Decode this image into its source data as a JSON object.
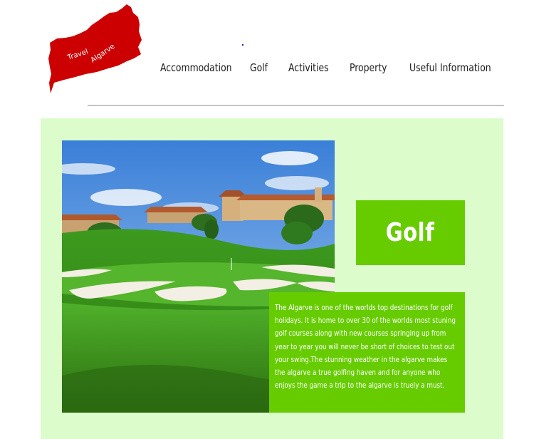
{
  "logo": {
    "line1": "Travel",
    "line2": "Algarve"
  },
  "nav": {
    "items": [
      {
        "label": "Accommodation"
      },
      {
        "label": "Golf"
      },
      {
        "label": "Activities"
      },
      {
        "label": "Property"
      },
      {
        "label": "Useful Information"
      }
    ]
  },
  "main": {
    "title": "Golf",
    "description": "The Algarve is one of the worlds top destinations for golf holidays. It is home to over 30 of the worlds most stuning golf courses along with new courses springing up from year to year you will never be short of choices to test out your swing.The stunning weather in the algarve makes the algarve a true golfing haven and for anyone who enjoys the game a trip to the algarve is truely a must."
  },
  "colors": {
    "logo_red": "#cc0000",
    "panel_green": "#ddfccb",
    "accent_green": "#66cc00"
  }
}
